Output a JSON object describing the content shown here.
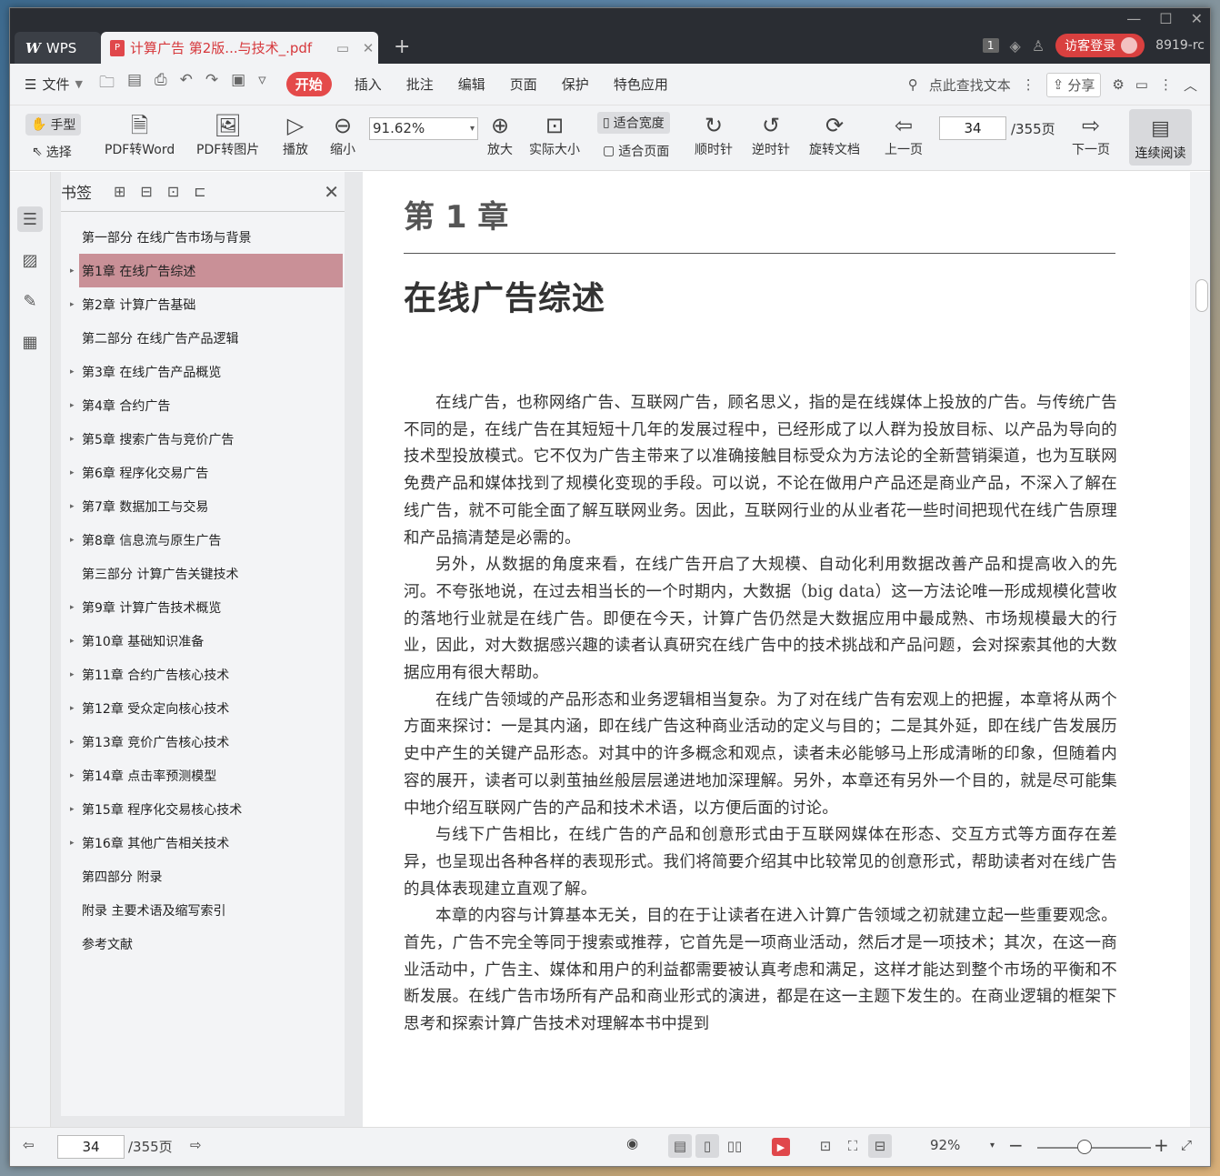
{
  "titlebar": {
    "wps_label": "WPS",
    "doc_tab_title": "计算广告 第2版...与技术_.pdf",
    "new_tab": "+",
    "badge": "1",
    "visitor_login": "访客登录",
    "user_id": "8919-rc"
  },
  "menubar": {
    "file": "文件",
    "tabs": [
      "开始",
      "插入",
      "批注",
      "编辑",
      "页面",
      "保护",
      "特色应用"
    ],
    "search_text": "点此查找文本",
    "share": "分享"
  },
  "toolbar": {
    "hand": "手型",
    "select": "选择",
    "pdf_to_word": "PDF转Word",
    "pdf_to_image": "PDF转图片",
    "play": "播放",
    "zoom_out": "缩小",
    "zoom_value": "91.62%",
    "zoom_in": "放大",
    "actual_size": "实际大小",
    "fit_width": "适合宽度",
    "fit_page": "适合页面",
    "clockwise": "顺时针",
    "counterclockwise": "逆时针",
    "rotate_doc": "旋转文档",
    "prev_page": "上一页",
    "page_current": "34",
    "page_total": "/355页",
    "next_page": "下一页",
    "continuous_read": "连续阅读"
  },
  "bookmarks": {
    "title": "书签",
    "items": [
      {
        "label": "第一部分 在线广告市场与背景",
        "caret": false
      },
      {
        "label": "第1章 在线广告综述",
        "caret": true
      },
      {
        "label": "第2章 计算广告基础",
        "caret": true
      },
      {
        "label": "第二部分 在线广告产品逻辑",
        "caret": false
      },
      {
        "label": "第3章 在线广告产品概览",
        "caret": true
      },
      {
        "label": "第4章 合约广告",
        "caret": true
      },
      {
        "label": "第5章 搜索广告与竞价广告",
        "caret": true
      },
      {
        "label": "第6章 程序化交易广告",
        "caret": true
      },
      {
        "label": "第7章 数据加工与交易",
        "caret": true
      },
      {
        "label": "第8章 信息流与原生广告",
        "caret": true
      },
      {
        "label": "第三部分 计算广告关键技术",
        "caret": false
      },
      {
        "label": "第9章 计算广告技术概览",
        "caret": true
      },
      {
        "label": "第10章 基础知识准备",
        "caret": true
      },
      {
        "label": "第11章 合约广告核心技术",
        "caret": true
      },
      {
        "label": "第12章 受众定向核心技术",
        "caret": true
      },
      {
        "label": "第13章 竞价广告核心技术",
        "caret": true
      },
      {
        "label": "第14章 点击率预测模型",
        "caret": true
      },
      {
        "label": "第15章 程序化交易核心技术",
        "caret": true
      },
      {
        "label": "第16章 其他广告相关技术",
        "caret": true
      },
      {
        "label": "第四部分 附录",
        "caret": false
      },
      {
        "label": "附录 主要术语及缩写索引",
        "caret": false
      },
      {
        "label": "参考文献",
        "caret": false
      }
    ]
  },
  "page": {
    "chapter_num": "第 1 章",
    "chapter_title": "在线广告综述",
    "paragraphs": [
      "在线广告，也称网络广告、互联网广告，顾名思义，指的是在线媒体上投放的广告。与传统广告不同的是，在线广告在其短短十几年的发展过程中，已经形成了以人群为投放目标、以产品为导向的技术型投放模式。它不仅为广告主带来了以准确接触目标受众为方法论的全新营销渠道，也为互联网免费产品和媒体找到了规模化变现的手段。可以说，不论在做用户产品还是商业产品，不深入了解在线广告，就不可能全面了解互联网业务。因此，互联网行业的从业者花一些时间把现代在线广告原理和产品搞清楚是必需的。",
      "另外，从数据的角度来看，在线广告开启了大规模、自动化利用数据改善产品和提高收入的先河。不夸张地说，在过去相当长的一个时期内，大数据（big data）这一方法论唯一形成规模化营收的落地行业就是在线广告。即便在今天，计算广告仍然是大数据应用中最成熟、市场规模最大的行业，因此，对大数据感兴趣的读者认真研究在线广告中的技术挑战和产品问题，会对探索其他的大数据应用有很大帮助。",
      "在线广告领域的产品形态和业务逻辑相当复杂。为了对在线广告有宏观上的把握，本章将从两个方面来探讨：一是其内涵，即在线广告这种商业活动的定义与目的；二是其外延，即在线广告发展历史中产生的关键产品形态。对其中的许多概念和观点，读者未必能够马上形成清晰的印象，但随着内容的展开，读者可以剥茧抽丝般层层递进地加深理解。另外，本章还有另外一个目的，就是尽可能集中地介绍互联网广告的产品和技术术语，以方便后面的讨论。",
      "与线下广告相比，在线广告的产品和创意形式由于互联网媒体在形态、交互方式等方面存在差异，也呈现出各种各样的表现形式。我们将简要介绍其中比较常见的创意形式，帮助读者对在线广告的具体表现建立直观了解。",
      "本章的内容与计算基本无关，目的在于让读者在进入计算广告领域之初就建立起一些重要观念。首先，广告不完全等同于搜索或推荐，它首先是一项商业活动，然后才是一项技术；其次，在这一商业活动中，广告主、媒体和用户的利益都需要被认真考虑和满足，这样才能达到整个市场的平衡和不断发展。在线广告市场所有产品和商业形式的演进，都是在这一主题下发生的。在商业逻辑的框架下思考和探索计算广告技术对理解本书中提到"
    ]
  },
  "statusbar": {
    "page_current": "34",
    "page_total": "/355页",
    "zoom": "92%"
  },
  "colors": {
    "accent_red": "#e44a4a",
    "selected_bookmark": "#c99097",
    "titlebar": "#2a2d33"
  }
}
